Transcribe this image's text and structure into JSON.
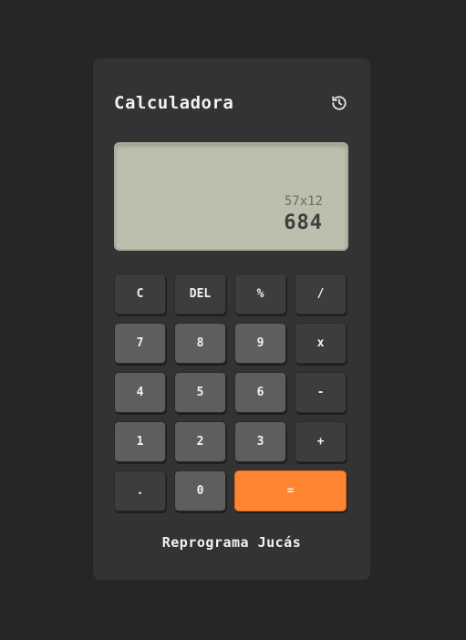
{
  "app": {
    "title": "Calculadora",
    "history_icon": "history-icon",
    "footer": "Reprograma Jucás"
  },
  "display": {
    "expression": "57x12",
    "result": "684"
  },
  "keys": {
    "clear": "C",
    "delete": "DEL",
    "percent": "%",
    "divide": "/",
    "seven": "7",
    "eight": "8",
    "nine": "9",
    "multiply": "x",
    "four": "4",
    "five": "5",
    "six": "6",
    "subtract": "-",
    "one": "1",
    "two": "2",
    "three": "3",
    "add": "+",
    "decimal": ".",
    "zero": "0",
    "equals": "="
  },
  "colors": {
    "background": "#262626",
    "panel": "#333333",
    "screen": "#bcbfad",
    "accent": "#ff8533"
  }
}
